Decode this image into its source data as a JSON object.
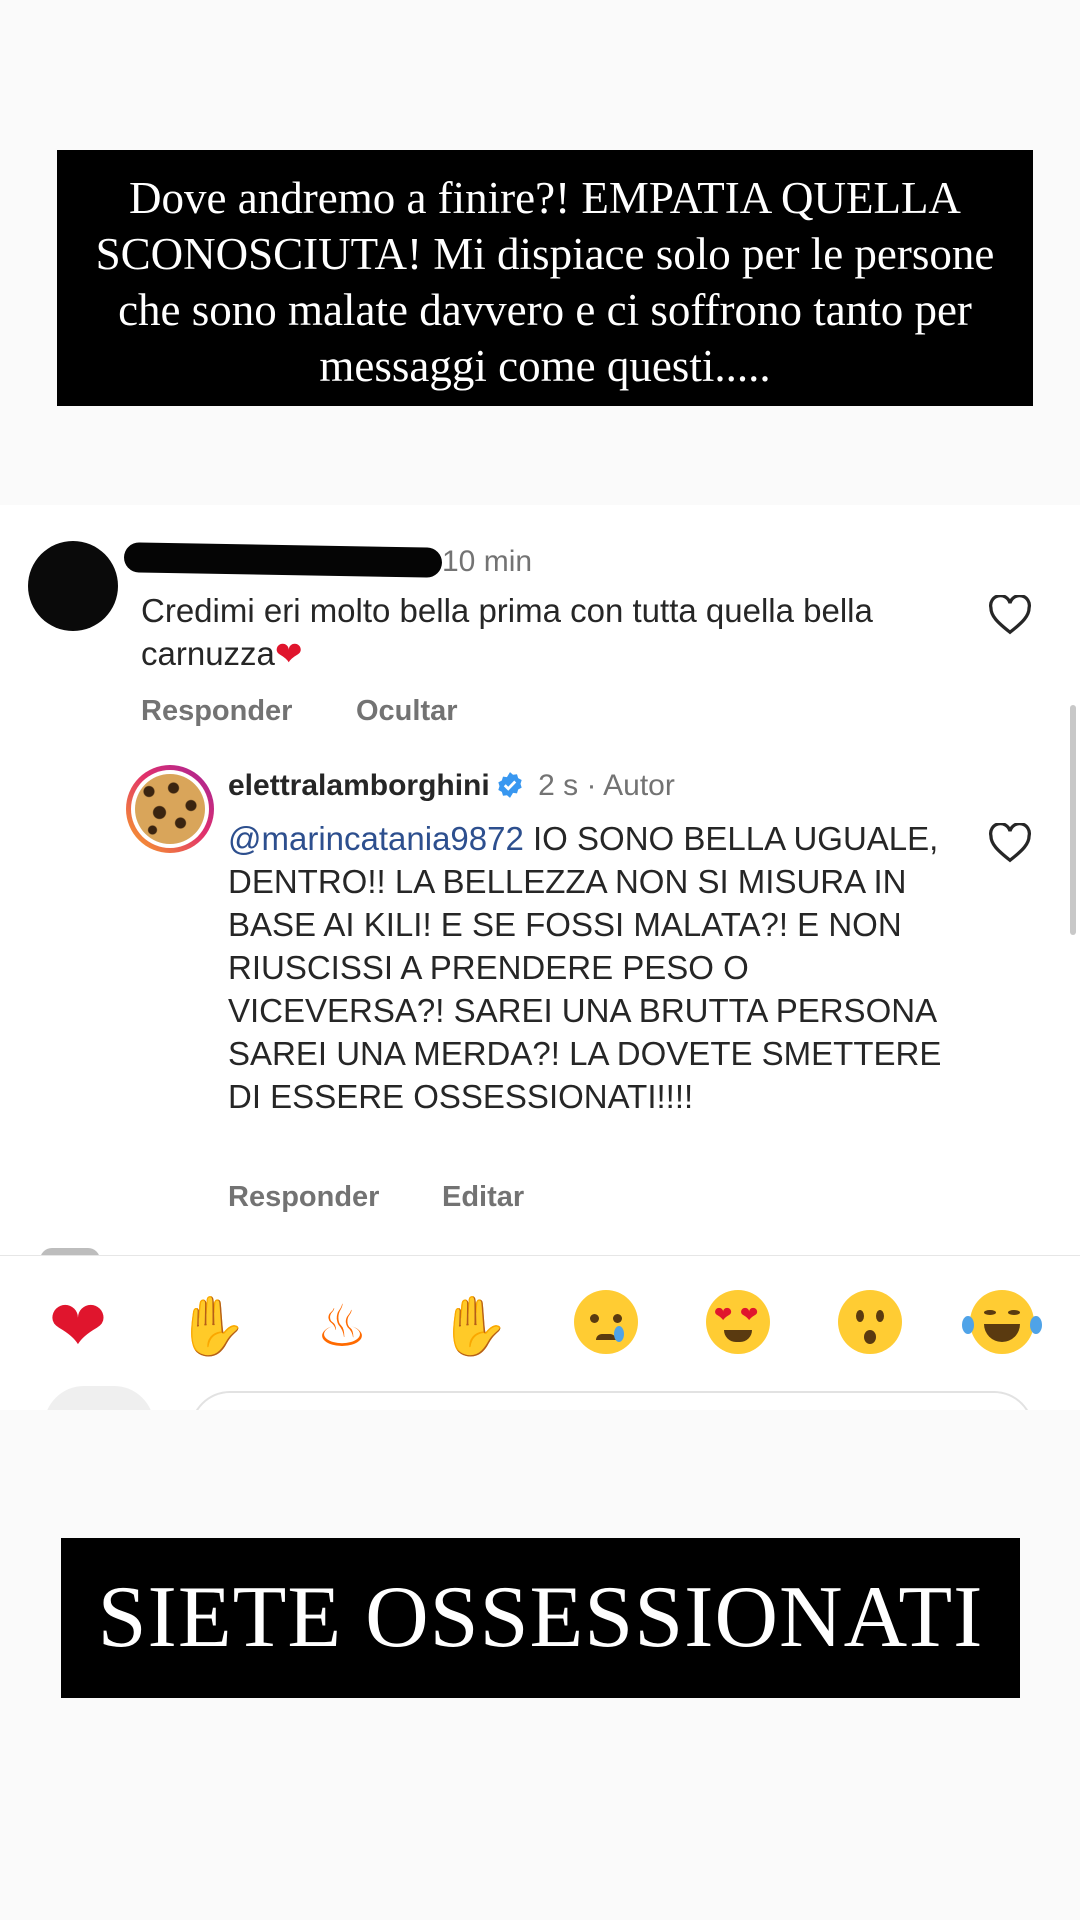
{
  "story": {
    "top_banner_text": "Dove andremo a finire?! EMPATIA QUELLA SCONOSCIUTA! Mi dispiace solo per le persone che sono malate davvero e ci soffrono tanto per messaggi come questi.....",
    "bottom_banner_text": "SIETE OSSESSIONATI"
  },
  "comment": {
    "timestamp": "10 min",
    "text": "Credimi eri molto bella prima con tutta quella bella carnuzza",
    "emoji": "❤️",
    "actions": {
      "reply": "Responder",
      "hide": "Ocultar"
    }
  },
  "reply": {
    "username": "elettralamborghini",
    "timestamp": "2 s",
    "separator": "·",
    "author_label": "Autor",
    "mention": "@marincatania9872",
    "text": "IO SONO BELLA UGUALE, DENTRO!! LA BELLEZZA NON SI MISURA IN BASE AI KILI! E SE FOSSI MALATA?! E NON RIUSCISSI A PRENDERE PESO O VICEVERSA?! SAREI UNA BRUTTA PERSONA SAREI UNA MERDA?! LA DOVETE SMETTERE DI ESSERE OSSESSIONATI!!!!",
    "actions": {
      "reply": "Responder",
      "edit": "Editar"
    }
  },
  "reactions": [
    "heart",
    "raised-hands",
    "fire",
    "clapping-hands",
    "crying-face",
    "heart-eyes-face",
    "surprised-face",
    "laughing-tears-face"
  ],
  "colors": {
    "banner_bg": "#000000",
    "verified_blue": "#3897f0",
    "mention": "#2d4f8e",
    "heart_red": "#e0152d"
  }
}
